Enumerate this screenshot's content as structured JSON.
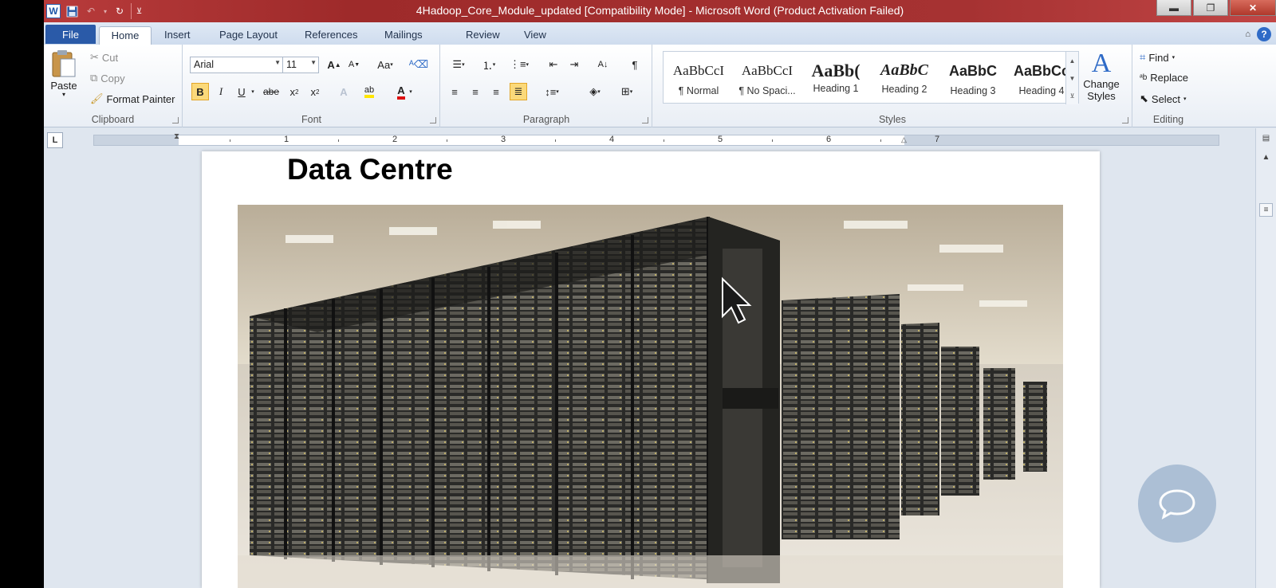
{
  "window": {
    "title": "4Hadoop_Core_Module_updated [Compatibility Mode]  -  Microsoft Word (Product Activation Failed)",
    "app_icon": "W"
  },
  "tabs": [
    {
      "label": "File"
    },
    {
      "label": "Home"
    },
    {
      "label": "Insert"
    },
    {
      "label": "Page Layout"
    },
    {
      "label": "References"
    },
    {
      "label": "Mailings"
    },
    {
      "label": "Review"
    },
    {
      "label": "View"
    }
  ],
  "clipboard": {
    "paste": "Paste",
    "cut": "Cut",
    "copy": "Copy",
    "format_painter": "Format Painter",
    "label": "Clipboard"
  },
  "font": {
    "family": "Arial",
    "size": "11",
    "label": "Font"
  },
  "paragraph": {
    "label": "Paragraph"
  },
  "styles": {
    "label": "Styles",
    "items": [
      {
        "sample": "AaBbCcI",
        "name": "¶ Normal"
      },
      {
        "sample": "AaBbCcI",
        "name": "¶ No Spaci..."
      },
      {
        "sample": "AaBb(",
        "name": "Heading 1"
      },
      {
        "sample": "AaBbC",
        "name": "Heading 2"
      },
      {
        "sample": "AaBbC",
        "name": "Heading 3"
      },
      {
        "sample": "AaBbCc",
        "name": "Heading 4"
      }
    ],
    "change_styles": "Change Styles"
  },
  "editing": {
    "find": "Find",
    "replace": "Replace",
    "select": "Select",
    "label": "Editing"
  },
  "ruler": {
    "numbers": [
      "1",
      "2",
      "3",
      "4",
      "5",
      "6",
      "7"
    ]
  },
  "document": {
    "heading": "Data Centre"
  },
  "colors": {
    "title_bar": "#a63232",
    "file_tab": "#2a5aa8",
    "pressed": "#fbd97a"
  }
}
